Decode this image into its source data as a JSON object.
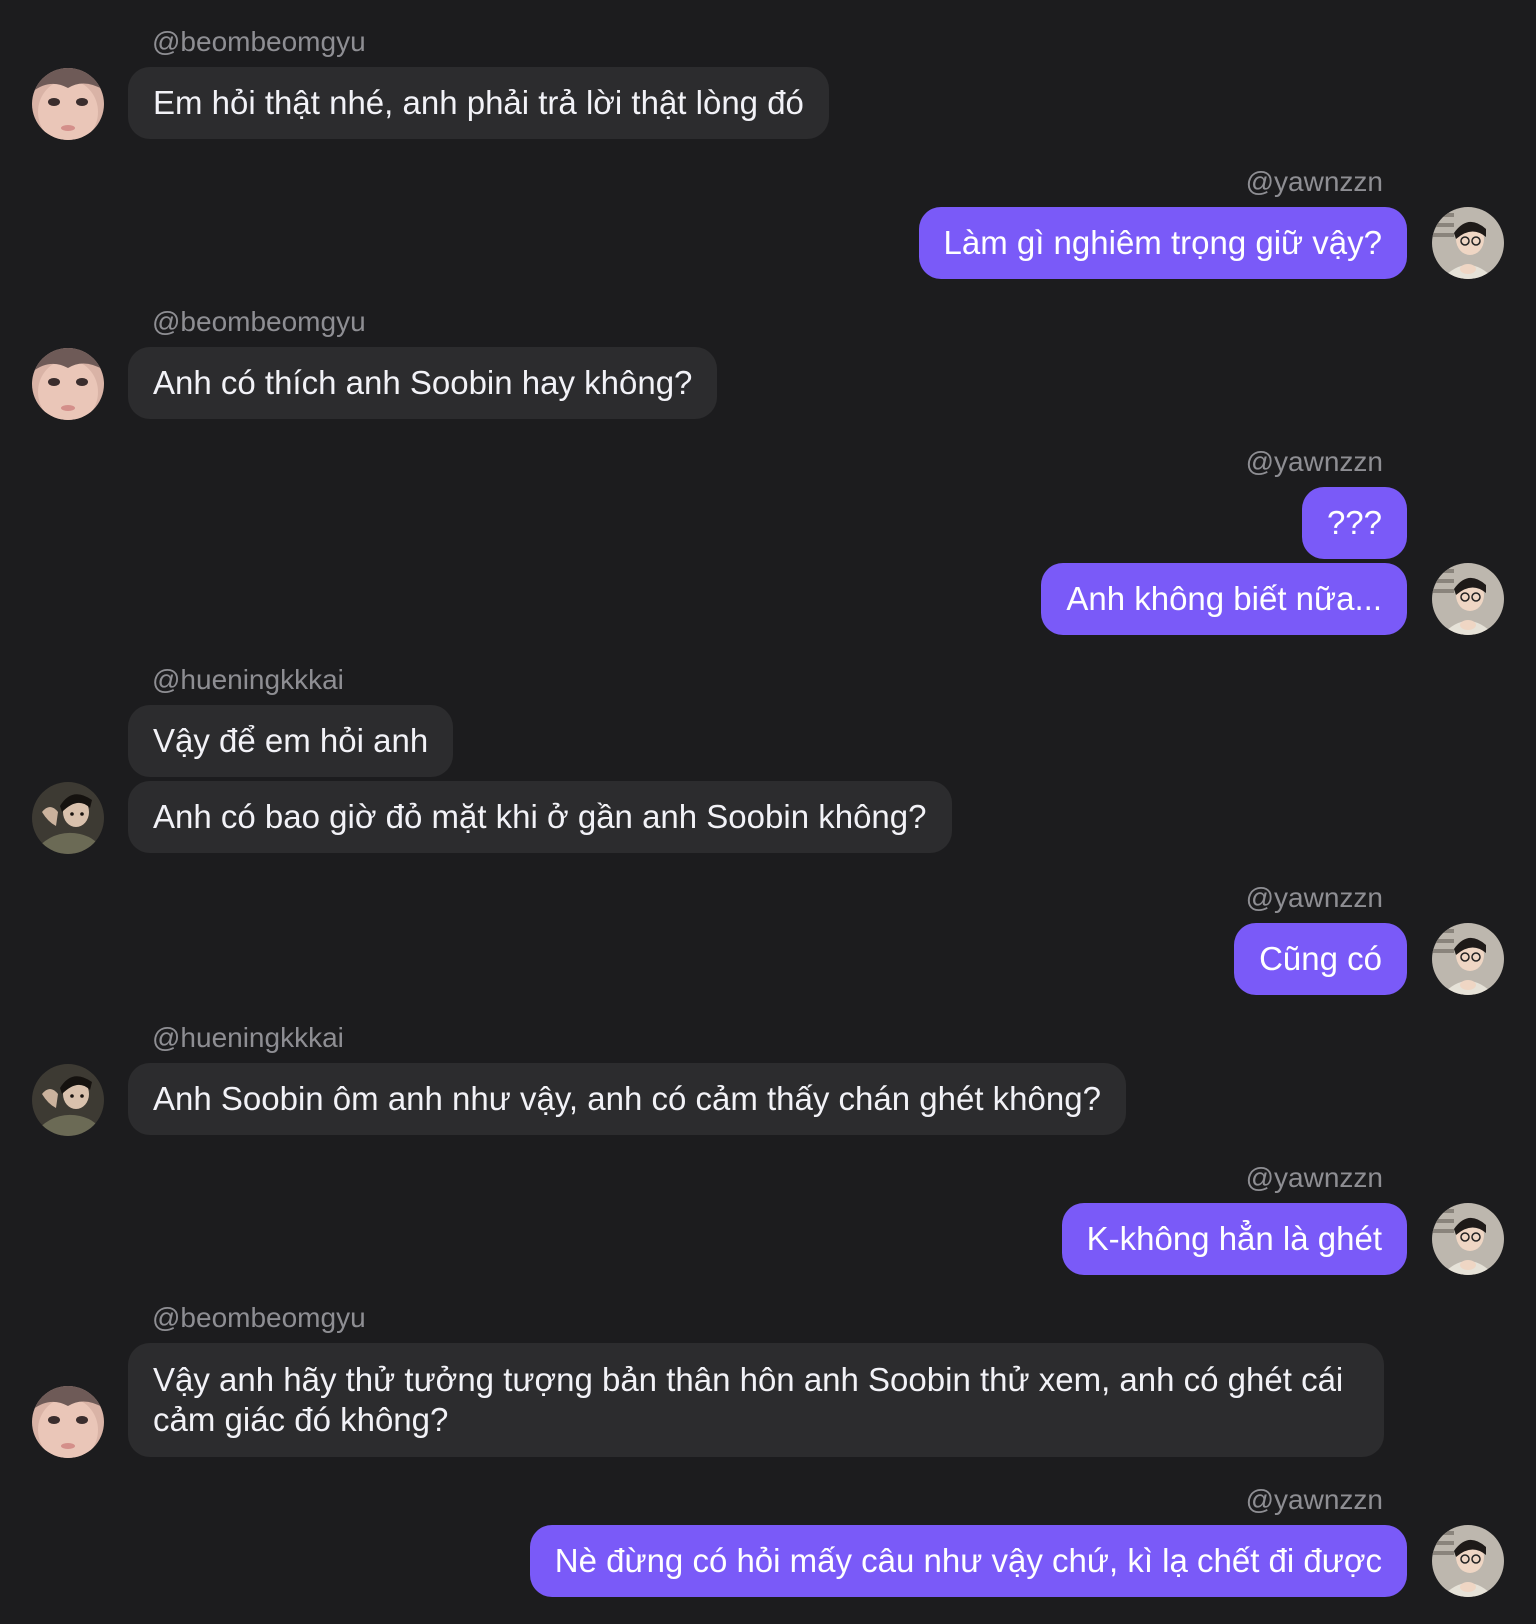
{
  "users": {
    "beomgyu": "@beombeomgyu",
    "yawnzzn": "@yawnzzn",
    "hueningkai": "@hueningkkkai"
  },
  "messages": [
    {
      "sender": "@beombeomgyu",
      "text": "Em hỏi thật nhé, anh phải trả lời thật lòng đó"
    },
    {
      "sender": "@yawnzzn",
      "text": "Làm gì nghiêm trọng giữ vậy?"
    },
    {
      "sender": "@beombeomgyu",
      "text": "Anh có thích anh Soobin hay không?"
    },
    {
      "sender": "@yawnzzn",
      "text": "???"
    },
    {
      "sender": "@yawnzzn",
      "text": "Anh không biết nữa..."
    },
    {
      "sender": "@hueningkkkai",
      "text": "Vậy để em hỏi anh"
    },
    {
      "sender": "@hueningkkkai",
      "text": "Anh có bao giờ đỏ mặt khi ở gần anh Soobin không?"
    },
    {
      "sender": "@yawnzzn",
      "text": "Cũng có"
    },
    {
      "sender": "@hueningkkkai",
      "text": "Anh Soobin ôm anh như vậy, anh có cảm thấy chán ghét không?"
    },
    {
      "sender": "@yawnzzn",
      "text": "K-không hẳn là ghét"
    },
    {
      "sender": "@beombeomgyu",
      "text": "Vậy anh hãy thử tưởng tượng bản thân hôn anh Soobin thử xem, anh có ghét cái cảm giác đó không?"
    },
    {
      "sender": "@yawnzzn",
      "text": "Nè đừng có hỏi mấy câu như vậy chứ, kì lạ chết đi được"
    }
  ],
  "colors": {
    "background": "#1c1c1e",
    "incoming_bubble": "#2c2c2e",
    "outgoing_bubble": "#7a5af8",
    "username": "#8e8e93"
  },
  "avatar_icons": {
    "beomgyu": "avatar-beomgyu-icon",
    "yawnzzn": "avatar-yawnzzn-icon",
    "hueningkai": "avatar-hueningkai-icon"
  }
}
